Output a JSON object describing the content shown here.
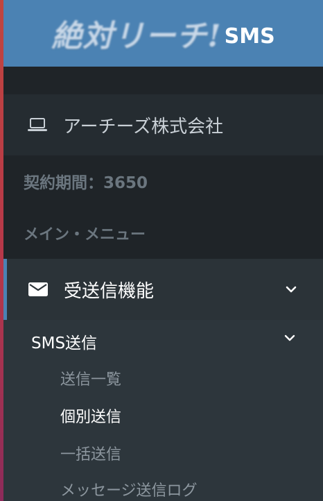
{
  "logo": {
    "main": "絶対リーチ!",
    "sub": "SMS"
  },
  "company": {
    "icon": "laptop-icon",
    "name": "アーチーズ株式会社"
  },
  "contract_period": "契約期間：3650",
  "main_menu_heading": "メイン・メニュー",
  "nav": {
    "send_feature": {
      "icon": "envelope-icon",
      "label": "受送信機能",
      "expanded": true
    },
    "sms_send": {
      "label": "SMS送信",
      "expanded": true
    },
    "items": [
      {
        "label": "送信一覧",
        "active": false
      },
      {
        "label": "個別送信",
        "active": true
      },
      {
        "label": "一括送信",
        "active": false
      },
      {
        "label": "メッセージ送信ログ",
        "active": false
      }
    ]
  },
  "colors": {
    "header_bg": "#4b82b3",
    "sidebar_bg": "#1f2428",
    "active_accent": "#4b82b3",
    "submenu_bg": "#2d363c"
  }
}
